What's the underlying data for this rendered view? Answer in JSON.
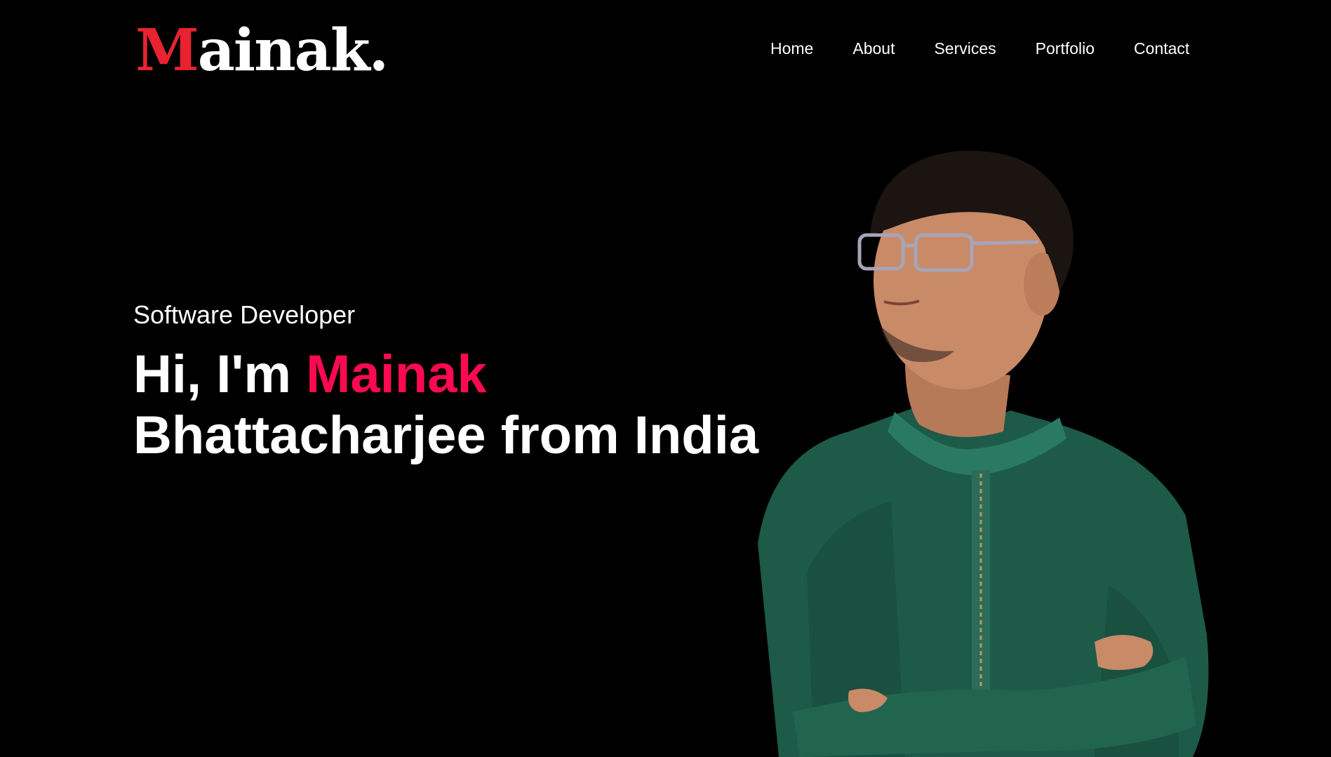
{
  "logo": {
    "initial": "M",
    "rest": "ainak."
  },
  "nav": {
    "items": [
      "Home",
      "About",
      "Services",
      "Portfolio",
      "Contact"
    ]
  },
  "hero": {
    "subtitle": "Software Developer",
    "greeting": "Hi, I'm ",
    "name_highlight": "Mainak",
    "name_rest": "Bhattacharjee from India"
  },
  "colors": {
    "background": "#000000",
    "accent_logo": "#e8232f",
    "accent_name": "#ff0a50",
    "text": "#ffffff",
    "shirt": "#1d5a48"
  }
}
